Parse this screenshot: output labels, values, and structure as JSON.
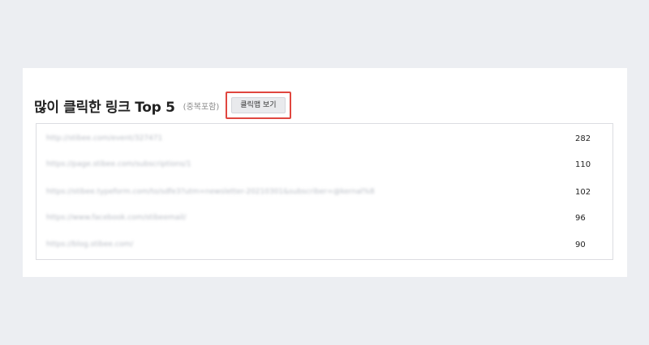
{
  "section": {
    "title": "많이 클릭한 링크 Top 5",
    "subtitle": "(중복포함)",
    "heatmap_button_label": "클릭맵 보기"
  },
  "links": [
    {
      "url": "http://stibee.com/event/327471",
      "count": "282"
    },
    {
      "url": "https://page.stibee.com/subscriptions/1",
      "count": "110"
    },
    {
      "url": "https://stibee.typeform.com/to/sdfe3?utm=newsletter-20210301&subscriber=@kernal%8",
      "count": "102"
    },
    {
      "url": "https://www.facebook.com/stibeemail/",
      "count": "96"
    },
    {
      "url": "https://blog.stibee.com/",
      "count": "90"
    }
  ]
}
